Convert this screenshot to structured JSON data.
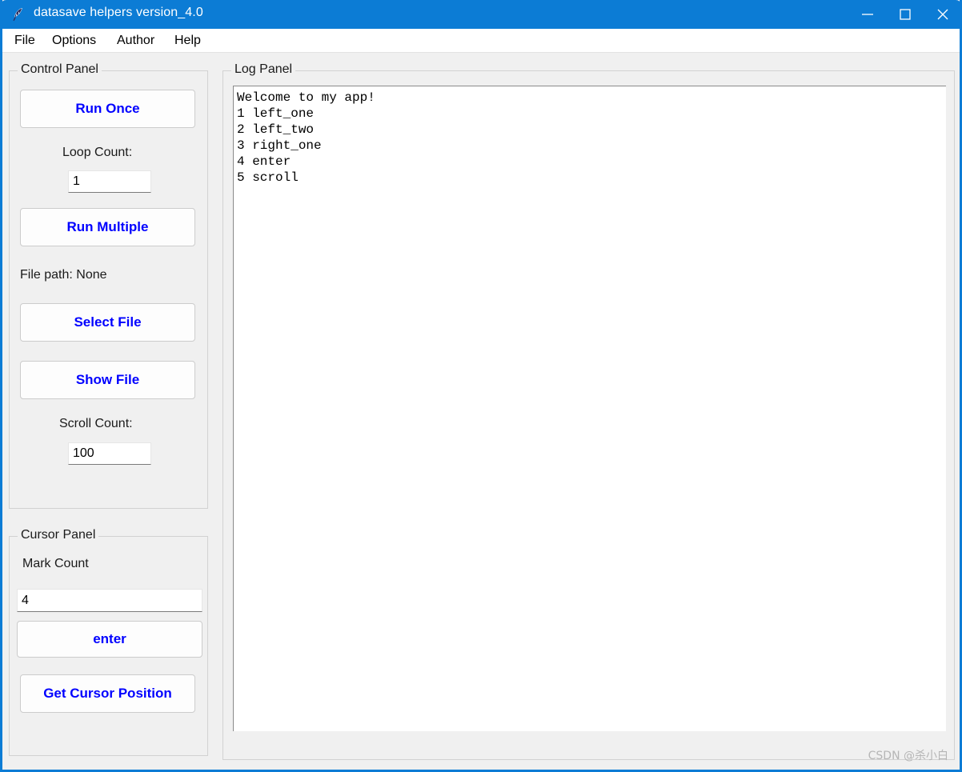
{
  "window": {
    "title": "datasave helpers version_4.0",
    "icon": "feather-icon",
    "accent_color": "#0c7cd5",
    "controls": {
      "minimize": "minimize-icon",
      "maximize": "maximize-icon",
      "close": "close-icon"
    }
  },
  "menubar": {
    "items": [
      {
        "label": "File"
      },
      {
        "label": "Options"
      },
      {
        "label": "Author"
      },
      {
        "label": "Help"
      }
    ]
  },
  "control_panel": {
    "title": "Control Panel",
    "run_once_label": "Run Once",
    "loop_count_label": "Loop Count:",
    "loop_count_value": "1",
    "run_multiple_label": "Run Multiple",
    "file_path_label": "File path: None",
    "select_file_label": "Select File",
    "show_file_label": "Show File",
    "scroll_count_label": "Scroll Count:",
    "scroll_count_value": "100"
  },
  "cursor_panel": {
    "title": "Cursor Panel",
    "mark_count_label": "Mark Count",
    "mark_count_value": "4",
    "enter_label": "enter",
    "get_cursor_position_label": "Get Cursor Position"
  },
  "log_panel": {
    "title": "Log Panel",
    "lines": [
      "Welcome to my app!",
      "1 left_one",
      "2 left_two",
      "3 right_one",
      "4 enter",
      "5 scroll"
    ]
  },
  "watermark": {
    "text": "CSDN @杀小白"
  },
  "theme": {
    "button_text_color": "#0000ff",
    "panel_background": "#f0f0f0",
    "titlebar_color": "#0c7cd5"
  }
}
